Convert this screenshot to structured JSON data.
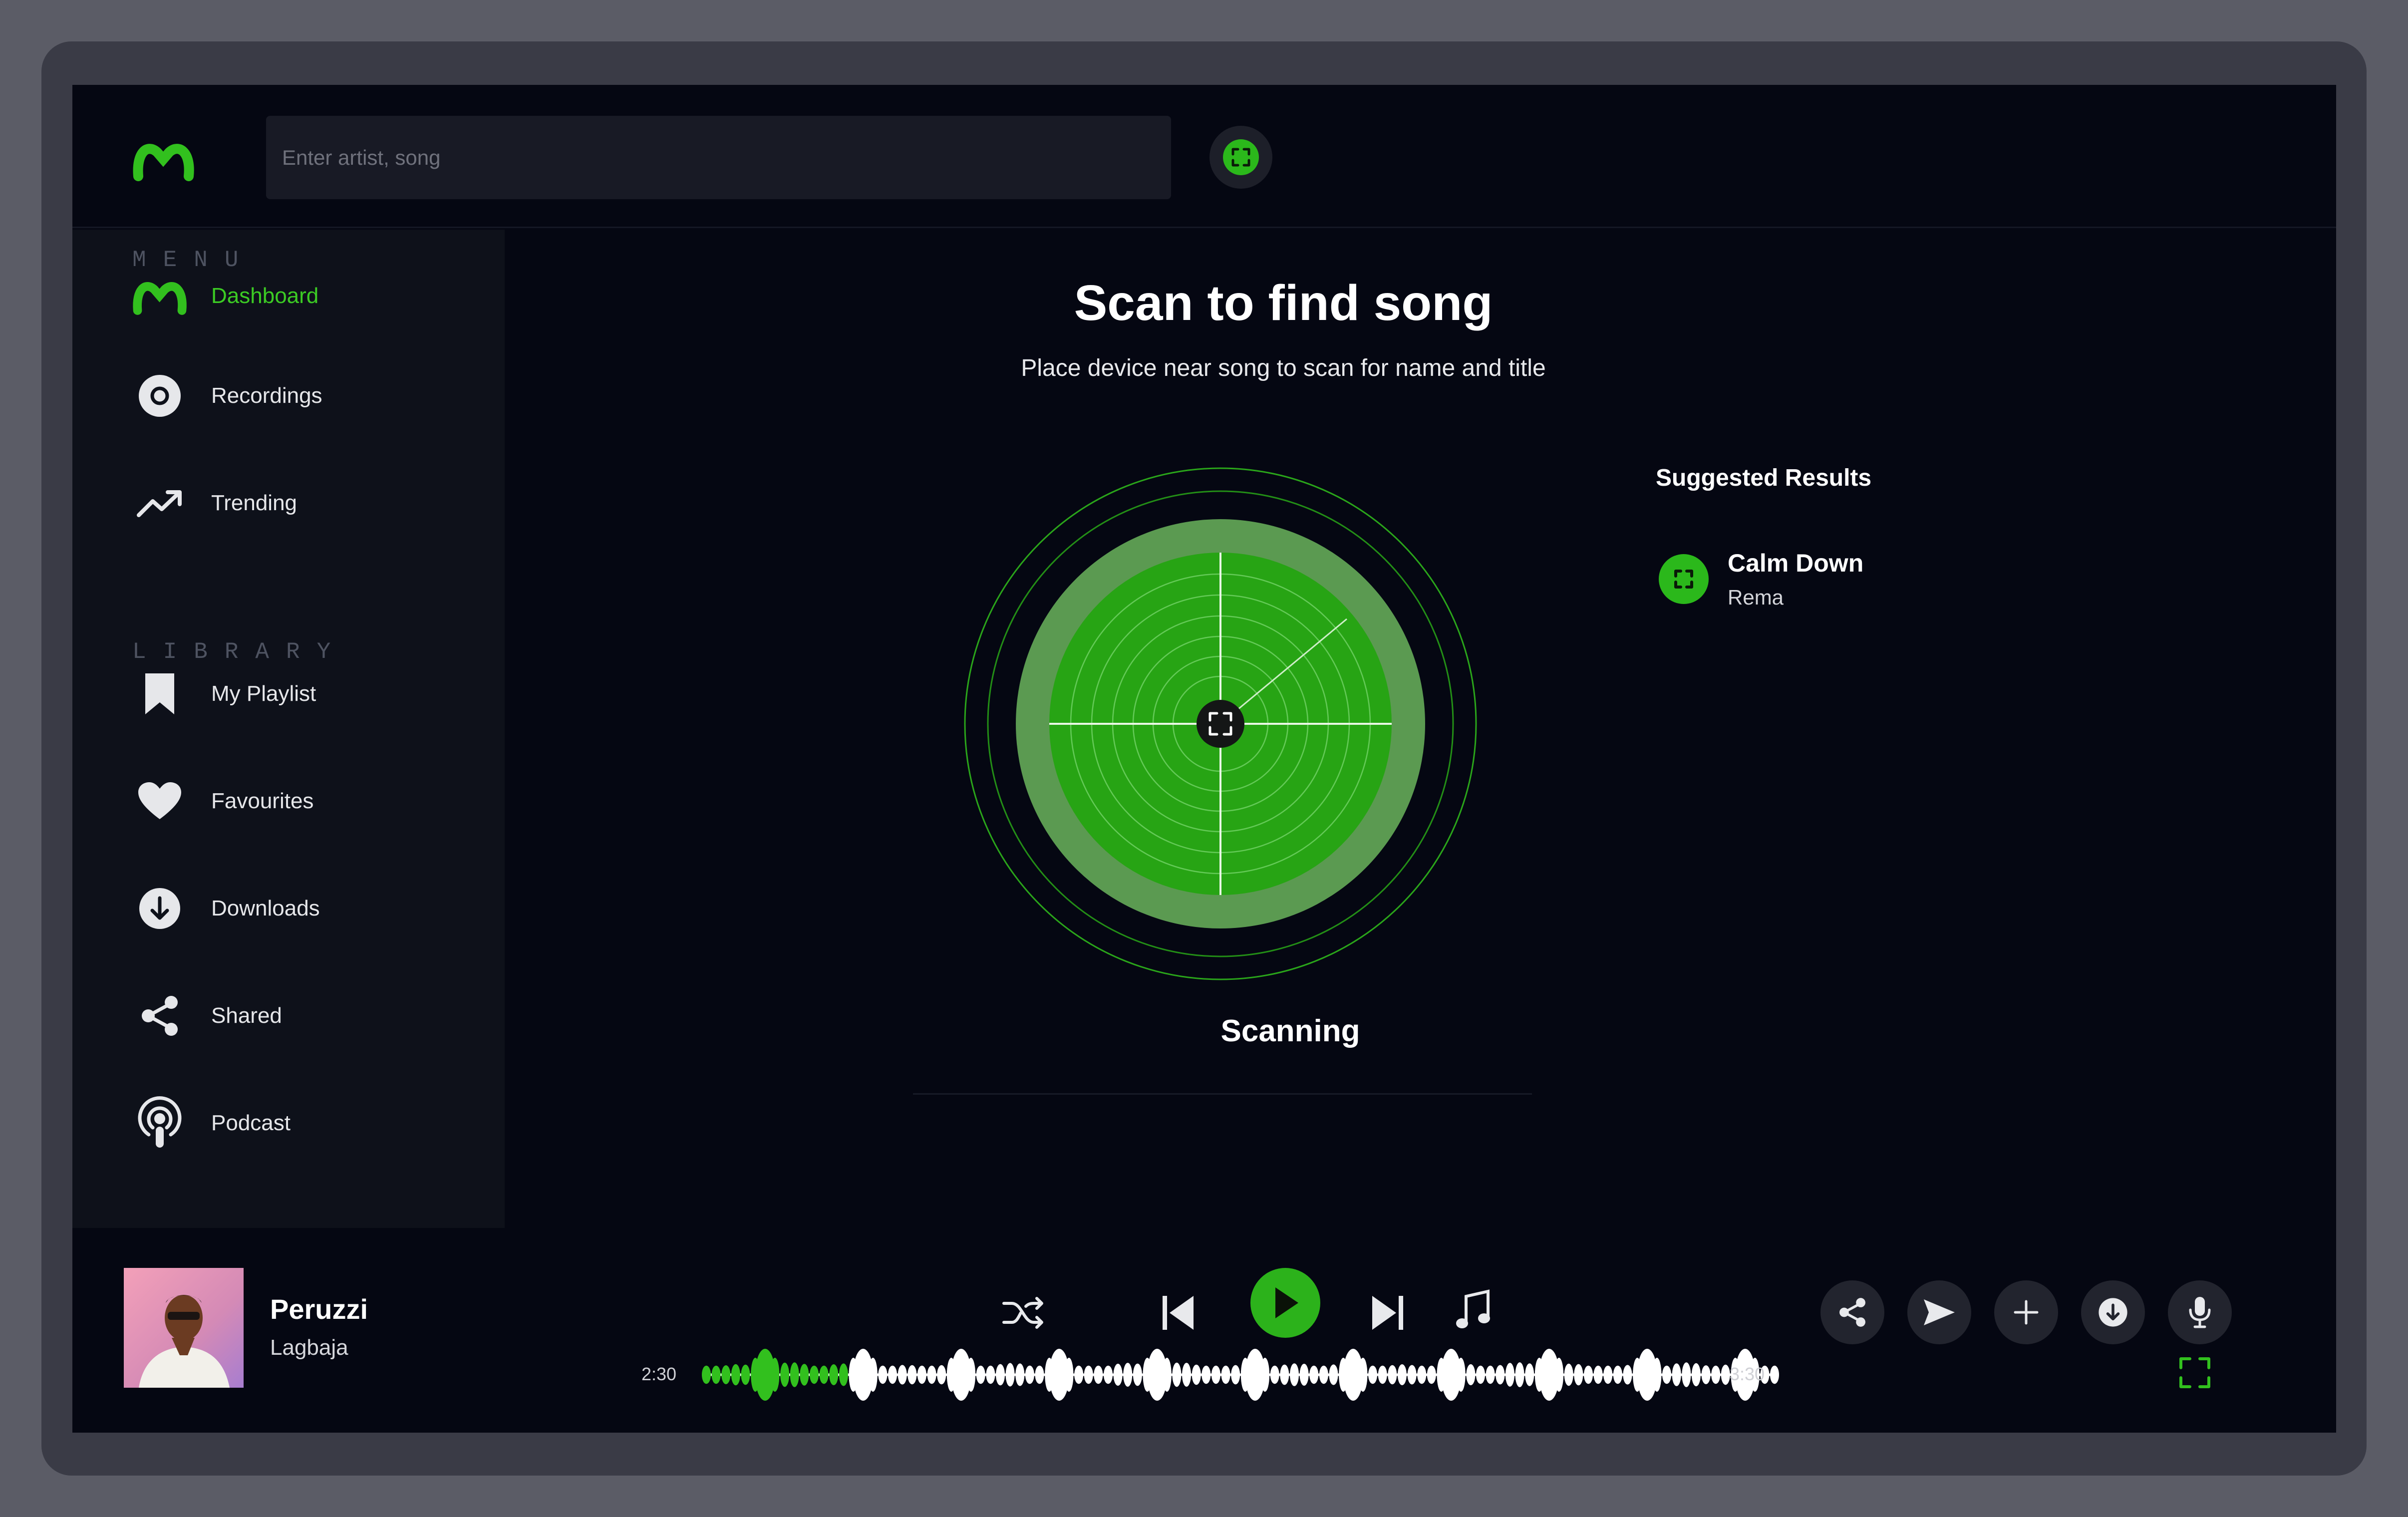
{
  "colors": {
    "accent": "#32c01e",
    "background": "#050712",
    "sidebar": "#0e111a"
  },
  "header": {
    "search_placeholder": "Enter artist, song",
    "logo_icon": "m-logo-icon",
    "scan_icon": "scan-icon"
  },
  "sidebar": {
    "menu_label": "MENU",
    "library_label": "LIBRARY",
    "menu_items": [
      {
        "label": "Dashboard",
        "icon": "m-logo-icon",
        "active": true
      },
      {
        "label": "Recordings",
        "icon": "disc-icon"
      },
      {
        "label": "Trending",
        "icon": "trending-icon"
      }
    ],
    "library_items": [
      {
        "label": "My Playlist",
        "icon": "bookmark-icon"
      },
      {
        "label": "Favourites",
        "icon": "heart-icon"
      },
      {
        "label": "Downloads",
        "icon": "download-icon"
      },
      {
        "label": "Shared",
        "icon": "share-icon"
      },
      {
        "label": "Podcast",
        "icon": "podcast-icon"
      }
    ]
  },
  "main": {
    "title": "Scan to find song",
    "subtitle": "Place device near song to scan for name and title",
    "status": "Scanning"
  },
  "suggested": {
    "title": "Suggested Results",
    "items": [
      {
        "title": "Calm Down",
        "artist": "Rema"
      }
    ]
  },
  "player": {
    "song_title": "Peruzzi",
    "artist": "Lagbaja",
    "time_elapsed": "2:30",
    "time_total": "3:30",
    "progress": 0.13,
    "controls": [
      "shuffle-icon",
      "previous-icon",
      "play-icon",
      "next-icon",
      "music-note-icon"
    ],
    "actions": [
      "share-icon",
      "send-icon",
      "plus-icon",
      "download-icon",
      "microphone-icon"
    ]
  }
}
